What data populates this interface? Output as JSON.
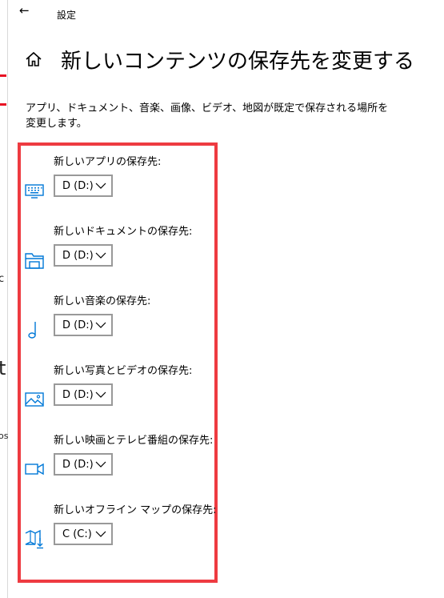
{
  "window": {
    "title": "設定",
    "back_glyph": "←"
  },
  "page": {
    "title": "新しいコンテンツの保存先を変更する",
    "description": "アプリ、ドキュメント、音楽、画像、ビデオ、地図が既定で保存される場所を変更します。"
  },
  "background_window": {
    "chars": [
      "c",
      "t",
      "os"
    ]
  },
  "settings": [
    {
      "label": "新しいアプリの保存先:",
      "value": "D (D:)",
      "icon": "keyboard-icon"
    },
    {
      "label": "新しいドキュメントの保存先:",
      "value": "D (D:)",
      "icon": "folder-icon"
    },
    {
      "label": "新しい音楽の保存先:",
      "value": "D (D:)",
      "icon": "music-note-icon"
    },
    {
      "label": "新しい写真とビデオの保存先:",
      "value": "D (D:)",
      "icon": "picture-icon"
    },
    {
      "label": "新しい映画とテレビ番組の保存先:",
      "value": "D (D:)",
      "icon": "video-camera-icon"
    },
    {
      "label": "新しいオフライン マップの保存先:",
      "value": "C (C:)",
      "icon": "map-download-icon"
    }
  ],
  "colors": {
    "accent": "#0078d7",
    "highlight_border": "#ee3b41",
    "dropdown_border": "#999999"
  }
}
